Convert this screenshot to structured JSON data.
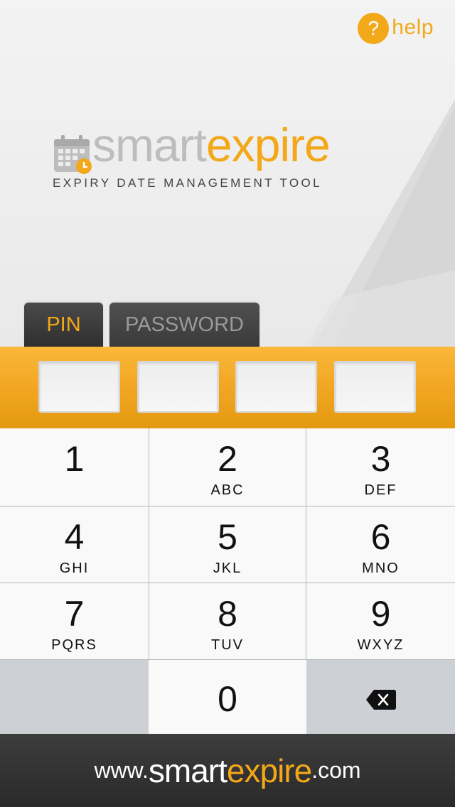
{
  "help": {
    "icon": "?",
    "label": "help"
  },
  "logo": {
    "smart": "smart",
    "expire": "expire",
    "tagline": "EXPIRY DATE MANAGEMENT TOOL"
  },
  "tabs": [
    {
      "label": "PIN",
      "active": true
    },
    {
      "label": "PASSWORD",
      "active": false
    }
  ],
  "pin_fields": [
    "",
    "",
    "",
    ""
  ],
  "keypad": {
    "k1": {
      "digit": "1",
      "letters": ""
    },
    "k2": {
      "digit": "2",
      "letters": "ABC"
    },
    "k3": {
      "digit": "3",
      "letters": "DEF"
    },
    "k4": {
      "digit": "4",
      "letters": "GHI"
    },
    "k5": {
      "digit": "5",
      "letters": "JKL"
    },
    "k6": {
      "digit": "6",
      "letters": "MNO"
    },
    "k7": {
      "digit": "7",
      "letters": "PQRS"
    },
    "k8": {
      "digit": "8",
      "letters": "TUV"
    },
    "k9": {
      "digit": "9",
      "letters": "WXYZ"
    },
    "k0": {
      "digit": "0",
      "letters": ""
    },
    "delete_icon": "backspace-icon"
  },
  "footer": {
    "prefix": "www.",
    "smart": "smart",
    "expire": "expire",
    "suffix": ".com"
  },
  "colors": {
    "accent": "#f2a818",
    "tab_dark": "#3a3a3a",
    "footer_dark": "#333333",
    "key_gray": "#cdd0d4"
  }
}
